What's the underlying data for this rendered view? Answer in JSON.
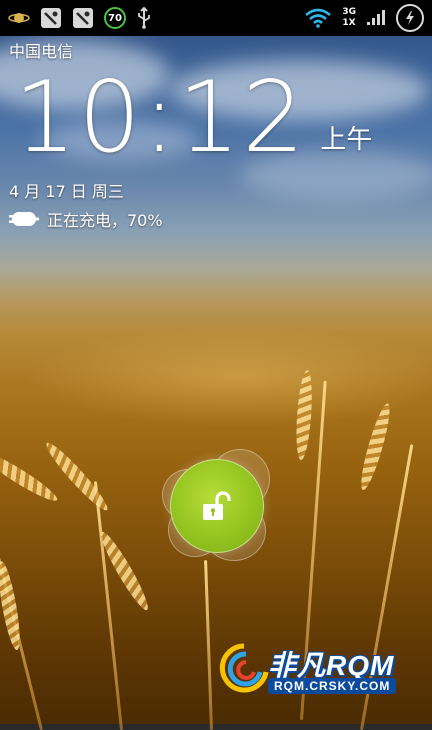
{
  "status_bar": {
    "left_icons": [
      "planet-icon",
      "notification-icon",
      "notification-icon",
      "speed-badge",
      "usb-icon"
    ],
    "speed_value": "70",
    "network_3g_label": "3G",
    "network_1x_label": "1X",
    "right_icons": [
      "wifi-icon",
      "signal-icon",
      "battery-charging-icon"
    ]
  },
  "lockscreen": {
    "carrier": "中国电信",
    "time": "10:12",
    "ampm": "上午",
    "date": "4 月 17 日 周三",
    "charging_text": "正在充电，70%",
    "battery_percent": 70
  },
  "unlock": {
    "icon": "unlock-padlock-icon",
    "accent_color": "#94c41f"
  },
  "watermark": {
    "title": "非凡RQM",
    "url": "RQM.CRSKY.COM"
  }
}
